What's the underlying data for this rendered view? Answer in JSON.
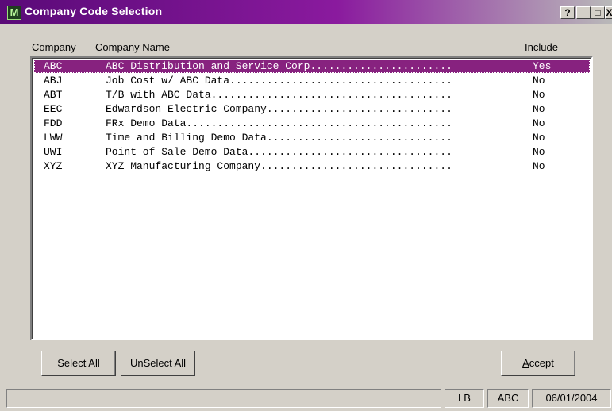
{
  "window": {
    "title": "Company Code Selection",
    "icon_letter": "M",
    "help_label": "?",
    "minimize_label": "_",
    "maximize_label": "□",
    "close_label": "X"
  },
  "columns": {
    "company": "Company",
    "company_name": "Company Name",
    "include": "Include"
  },
  "companies": [
    {
      "code": "ABC",
      "name": "ABC Distribution and Service Corp.......................",
      "include": "Yes",
      "selected": true
    },
    {
      "code": "ABJ",
      "name": "Job Cost w/ ABC Data....................................",
      "include": "No"
    },
    {
      "code": "ABT",
      "name": "T/B with ABC Data.......................................",
      "include": "No"
    },
    {
      "code": "EEC",
      "name": "Edwardson Electric Company..............................",
      "include": "No"
    },
    {
      "code": "FDD",
      "name": "FRx Demo Data...........................................",
      "include": "No"
    },
    {
      "code": "LWW",
      "name": "Time and Billing Demo Data..............................",
      "include": "No"
    },
    {
      "code": "UWI",
      "name": "Point of Sale Demo Data.................................",
      "include": "No"
    },
    {
      "code": "XYZ",
      "name": "XYZ Manufacturing Company...............................",
      "include": "No"
    }
  ],
  "buttons": {
    "select_all": "Select All",
    "unselect_all": "UnSelect All",
    "accept": "Accept"
  },
  "statusbar": {
    "user": "LB",
    "company": "ABC",
    "date": "06/01/2004"
  },
  "colors": {
    "selection": "#87227f",
    "titlebar": "#5a0a78",
    "face": "#d4d0c8"
  }
}
